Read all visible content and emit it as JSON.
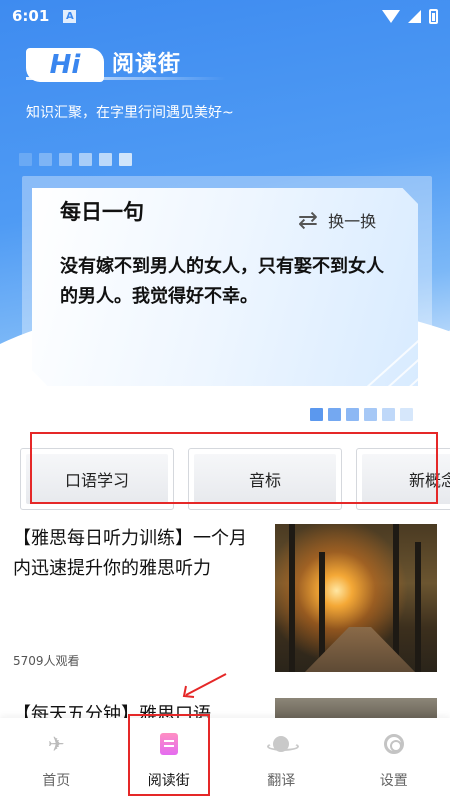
{
  "status_bar": {
    "time": "6:01",
    "notification_glyph": "A"
  },
  "hero": {
    "badge": "Hi",
    "title": "阅读街",
    "subtitle": "知识汇聚，在字里行间遇见美好~",
    "deco_colors": [
      "#6aa9f4",
      "#7db4f5",
      "#92c0f7",
      "#a8cdf8",
      "#bcd9fa",
      "#d0e5fb"
    ]
  },
  "quote": {
    "title": "每日一句",
    "refresh_label": "换一换",
    "text": "没有嫁不到男人的女人，只有娶不到女人的男人。我觉得好不幸。"
  },
  "pager_colors": [
    "#5b98ee",
    "#74a8f1",
    "#8db8f4",
    "#a6c8f6",
    "#bfd8f9",
    "#d6e7fb"
  ],
  "categories": [
    {
      "label": "口语学习"
    },
    {
      "label": "音标"
    },
    {
      "label": "新概念"
    }
  ],
  "articles": [
    {
      "title": "【雅思每日听力训练】一个月内迅速提升你的雅思听力",
      "views": "5709人观看"
    },
    {
      "title": "【每天五分钟】雅思口语"
    }
  ],
  "nav": {
    "items": [
      {
        "label": "首页",
        "icon": "plane-icon"
      },
      {
        "label": "阅读街",
        "icon": "document-icon"
      },
      {
        "label": "翻译",
        "icon": "planet-icon"
      },
      {
        "label": "设置",
        "icon": "gear-icon"
      }
    ]
  },
  "colors": {
    "accent": "#3e8bf0",
    "annotation": "#e52828"
  }
}
